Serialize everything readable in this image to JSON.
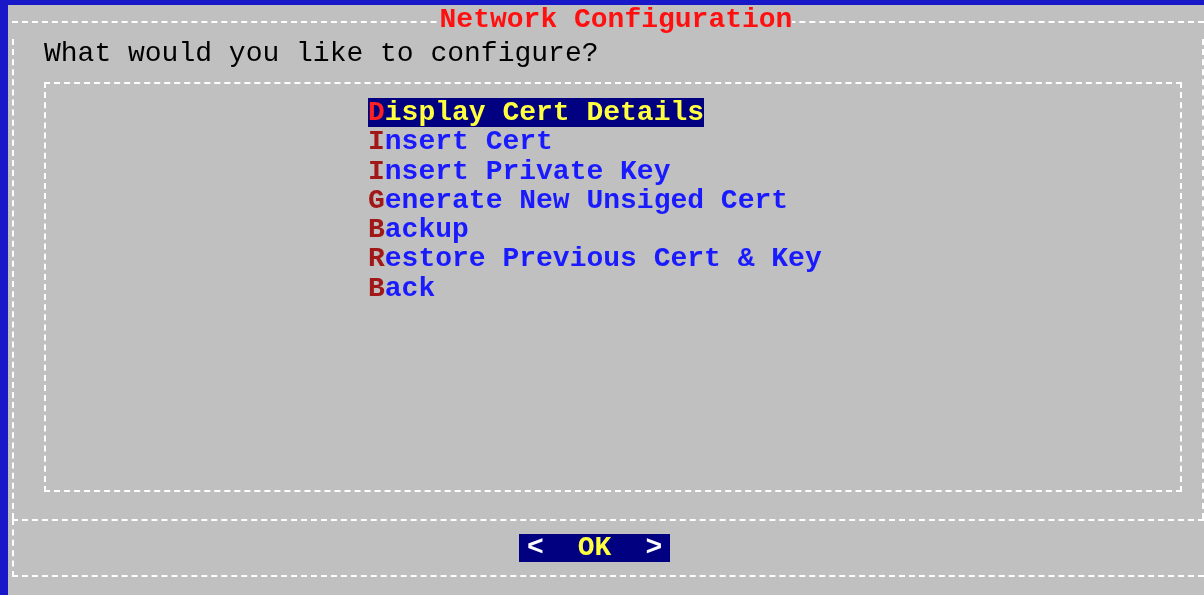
{
  "dialog": {
    "title": "Network Configuration",
    "prompt": "What would you like to configure?",
    "menu": [
      {
        "label": "Display Cert Details",
        "selected": true
      },
      {
        "label": "Insert Cert",
        "selected": false
      },
      {
        "label": "Insert Private Key",
        "selected": false
      },
      {
        "label": "Generate New Unsiged Cert",
        "selected": false
      },
      {
        "label": "Backup",
        "selected": false
      },
      {
        "label": "Restore Previous Cert & Key",
        "selected": false
      },
      {
        "label": "Back",
        "selected": false
      }
    ],
    "button": {
      "left": "<",
      "label": "OK",
      "right": ">",
      "selected": true
    }
  }
}
